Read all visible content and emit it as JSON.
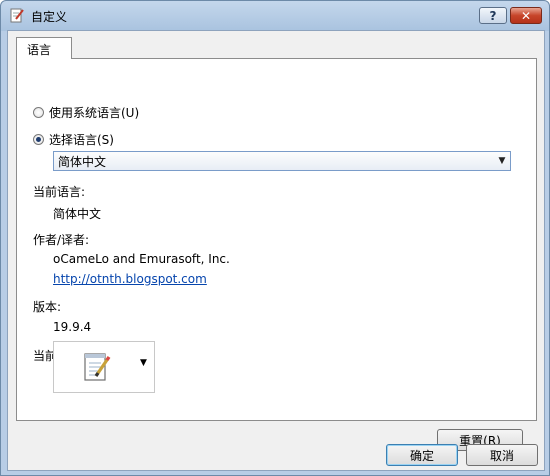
{
  "window": {
    "title": "自定义",
    "help_label": "?",
    "close_label": "✕"
  },
  "tab": {
    "label": "语言"
  },
  "language": {
    "use_system_label": "使用系统语言(U)",
    "select_label": "选择语言(S)",
    "selected_option": "简体中文",
    "current_label": "当前语言:",
    "current_value": "简体中文"
  },
  "author": {
    "label": "作者/译者:",
    "name": "oCameLo and Emurasoft, Inc.",
    "url": "http://otnth.blogspot.com"
  },
  "version": {
    "label": "版本:",
    "value": "19.9.4"
  },
  "current_icon": {
    "label": "当前图标(I):"
  },
  "buttons": {
    "reset": "重置(R)",
    "ok": "确定",
    "cancel": "取消"
  },
  "icons": {
    "app": "notepad-pen-icon",
    "dropdown": "chevron-down-icon"
  }
}
